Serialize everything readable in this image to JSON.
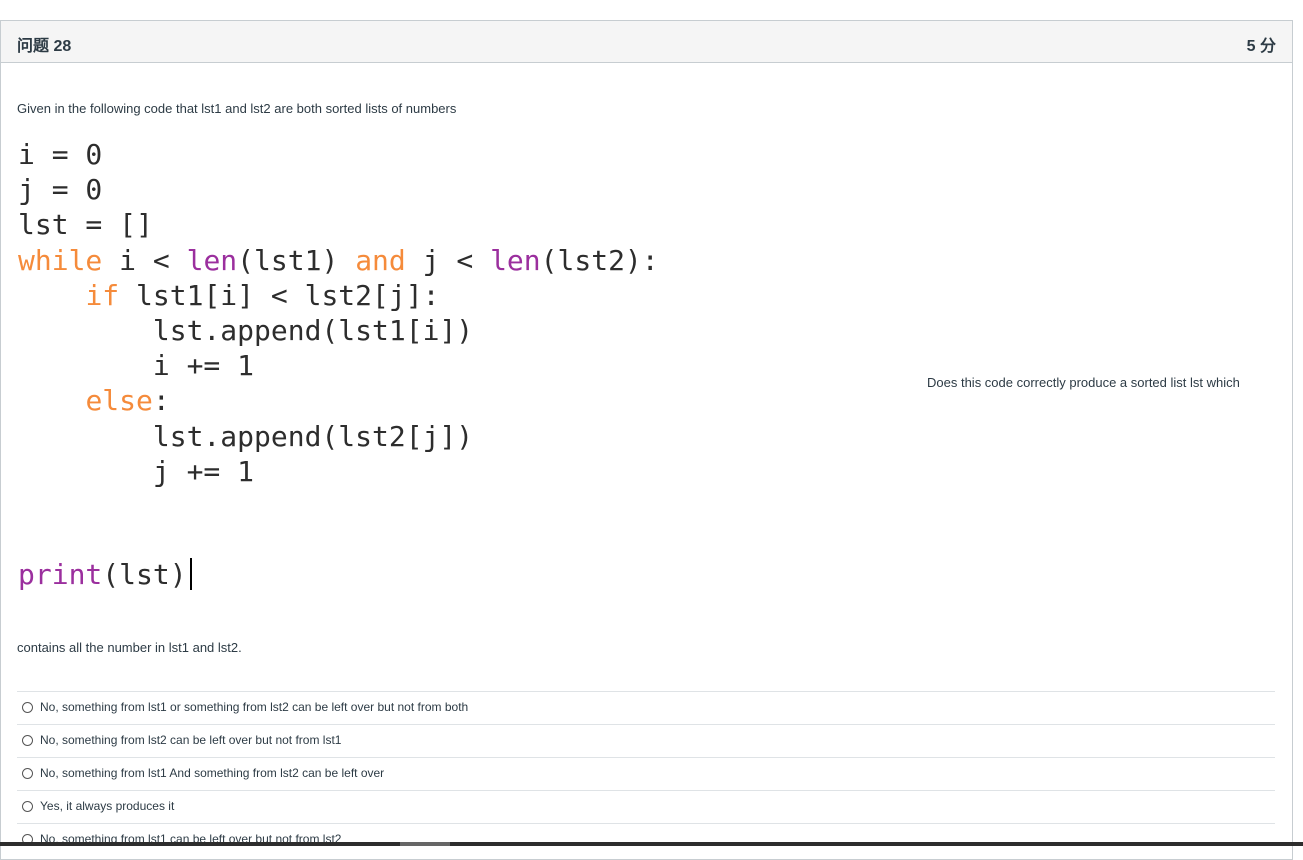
{
  "question": {
    "title": "问题 28",
    "points": "5 分",
    "intro": "Given in the following code that lst1 and lst2 are both sorted lists of numbers",
    "side_text": "Does this code correctly produce a sorted list lst which",
    "outro": "contains all the number in lst1 and lst2."
  },
  "code": {
    "line1": "i = 0",
    "line2": "j = 0",
    "line3": "lst = []",
    "line4_kw": "while",
    "line4_a": " i < ",
    "line4_fn1": "len",
    "line4_b": "(lst1) ",
    "line4_and": "and",
    "line4_c": " j < ",
    "line4_fn2": "len",
    "line4_d": "(lst2):",
    "line5_indent": "    ",
    "line5_kw": "if",
    "line5_rest": " lst1[i] < lst2[j]:",
    "line6": "        lst.append(lst1[i])",
    "line7": "        i += 1",
    "line8_indent": "    ",
    "line8_kw": "else",
    "line8_rest": ":",
    "line9": "        lst.append(lst2[j])",
    "line10": "        j += 1",
    "print_fn": "print",
    "print_rest": "(lst)"
  },
  "answers": [
    "No, something from lst1 or something from lst2 can be left over but not from both",
    "No, something from lst2 can be left over but not from lst1",
    "No, something from lst1 And something from lst2 can be left over",
    "Yes, it always produces it",
    "No, something from lst1 can be left over but not from lst2"
  ]
}
